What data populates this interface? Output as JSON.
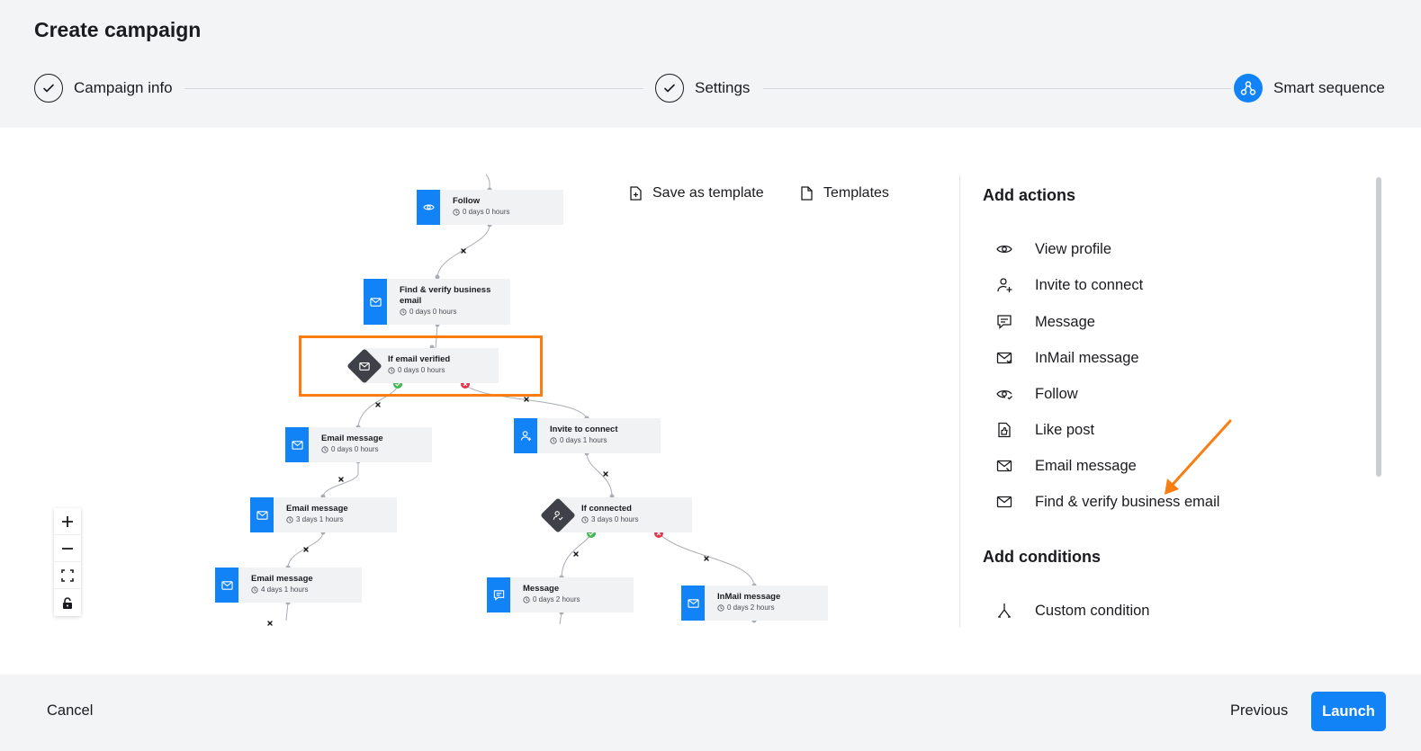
{
  "header": {
    "title": "Create campaign",
    "steps": [
      {
        "label": "Campaign info",
        "state": "done"
      },
      {
        "label": "Settings",
        "state": "done"
      },
      {
        "label": "Smart sequence",
        "state": "active"
      }
    ]
  },
  "toolbar": {
    "save_template_label": "Save as template",
    "templates_label": "Templates"
  },
  "flow": {
    "nodes": [
      {
        "title": "Follow",
        "time": "0 days 0 hours",
        "icon": "eye-icon"
      },
      {
        "title": "Find & verify business email",
        "time": "0 days 0 hours",
        "icon": "mail-check-icon"
      },
      {
        "title": "If email verified",
        "time": "0 days 0 hours",
        "icon": "mail-condition-icon"
      },
      {
        "title": "Email message",
        "time": "0 days 0 hours",
        "icon": "mail-icon"
      },
      {
        "title": "Invite to connect",
        "time": "0 days 1 hours",
        "icon": "person-add-icon"
      },
      {
        "title": "Email message",
        "time": "3 days 1 hours",
        "icon": "mail-icon"
      },
      {
        "title": "If connected",
        "time": "3 days 0 hours",
        "icon": "person-condition-icon"
      },
      {
        "title": "Email message",
        "time": "4 days 1 hours",
        "icon": "mail-icon"
      },
      {
        "title": "Message",
        "time": "0 days 2 hours",
        "icon": "chat-icon"
      },
      {
        "title": "InMail message",
        "time": "0 days 2 hours",
        "icon": "inmail-icon"
      }
    ]
  },
  "zoom_controls": [
    "zoom-in",
    "zoom-out",
    "fit-view",
    "lock"
  ],
  "sidebar": {
    "actions_title": "Add actions",
    "actions": [
      {
        "label": "View profile",
        "icon": "eye-icon"
      },
      {
        "label": "Invite to connect",
        "icon": "person-add-icon"
      },
      {
        "label": "Message",
        "icon": "chat-icon"
      },
      {
        "label": "InMail message",
        "icon": "inmail-icon"
      },
      {
        "label": "Follow",
        "icon": "eye-follow-icon"
      },
      {
        "label": "Like post",
        "icon": "thumbs-up-icon"
      },
      {
        "label": "Email message",
        "icon": "mail-icon"
      },
      {
        "label": "Find & verify business email",
        "icon": "mail-check-icon"
      }
    ],
    "conditions_title": "Add conditions",
    "conditions": [
      {
        "label": "Custom condition",
        "icon": "branch-icon"
      }
    ]
  },
  "footer": {
    "cancel_label": "Cancel",
    "previous_label": "Previous",
    "launch_label": "Launch"
  },
  "colors": {
    "accent": "#1183f7",
    "highlight": "#fa7d12",
    "success": "#3fb950",
    "danger": "#e5334b",
    "condition_node": "#3f4148"
  }
}
